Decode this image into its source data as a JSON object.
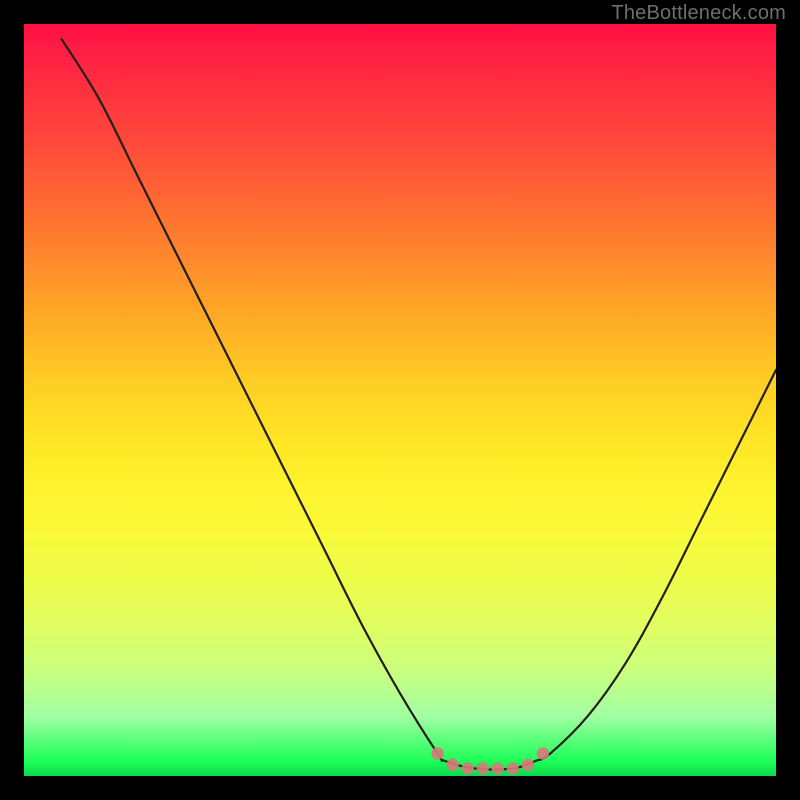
{
  "watermark": "TheBottleneck.com",
  "chart_data": {
    "type": "line",
    "title": "",
    "xlabel": "",
    "ylabel": "",
    "xlim": [
      0,
      100
    ],
    "ylim": [
      0,
      100
    ],
    "series": [
      {
        "name": "bottleneck-curve",
        "x": [
          5,
          10,
          15,
          20,
          25,
          30,
          35,
          40,
          45,
          50,
          55,
          56,
          60,
          65,
          68,
          70,
          75,
          80,
          85,
          90,
          95,
          100
        ],
        "y": [
          98,
          90,
          80,
          70,
          60,
          50,
          40,
          30,
          20,
          11,
          3,
          2,
          1,
          1,
          2,
          3,
          8,
          15,
          24,
          34,
          44,
          54
        ]
      }
    ],
    "markers": [
      {
        "x": 55,
        "y": 3,
        "name": "marker-left-shoulder"
      },
      {
        "x": 57,
        "y": 1.5,
        "name": "marker-a"
      },
      {
        "x": 59,
        "y": 1,
        "name": "marker-b"
      },
      {
        "x": 61,
        "y": 1,
        "name": "marker-c"
      },
      {
        "x": 63,
        "y": 1,
        "name": "marker-d"
      },
      {
        "x": 65,
        "y": 1,
        "name": "marker-e"
      },
      {
        "x": 67,
        "y": 1.5,
        "name": "marker-f"
      },
      {
        "x": 69,
        "y": 3,
        "name": "marker-right-shoulder"
      }
    ],
    "marker_color": "#d77a7a",
    "curve_color": "#231f1d"
  }
}
